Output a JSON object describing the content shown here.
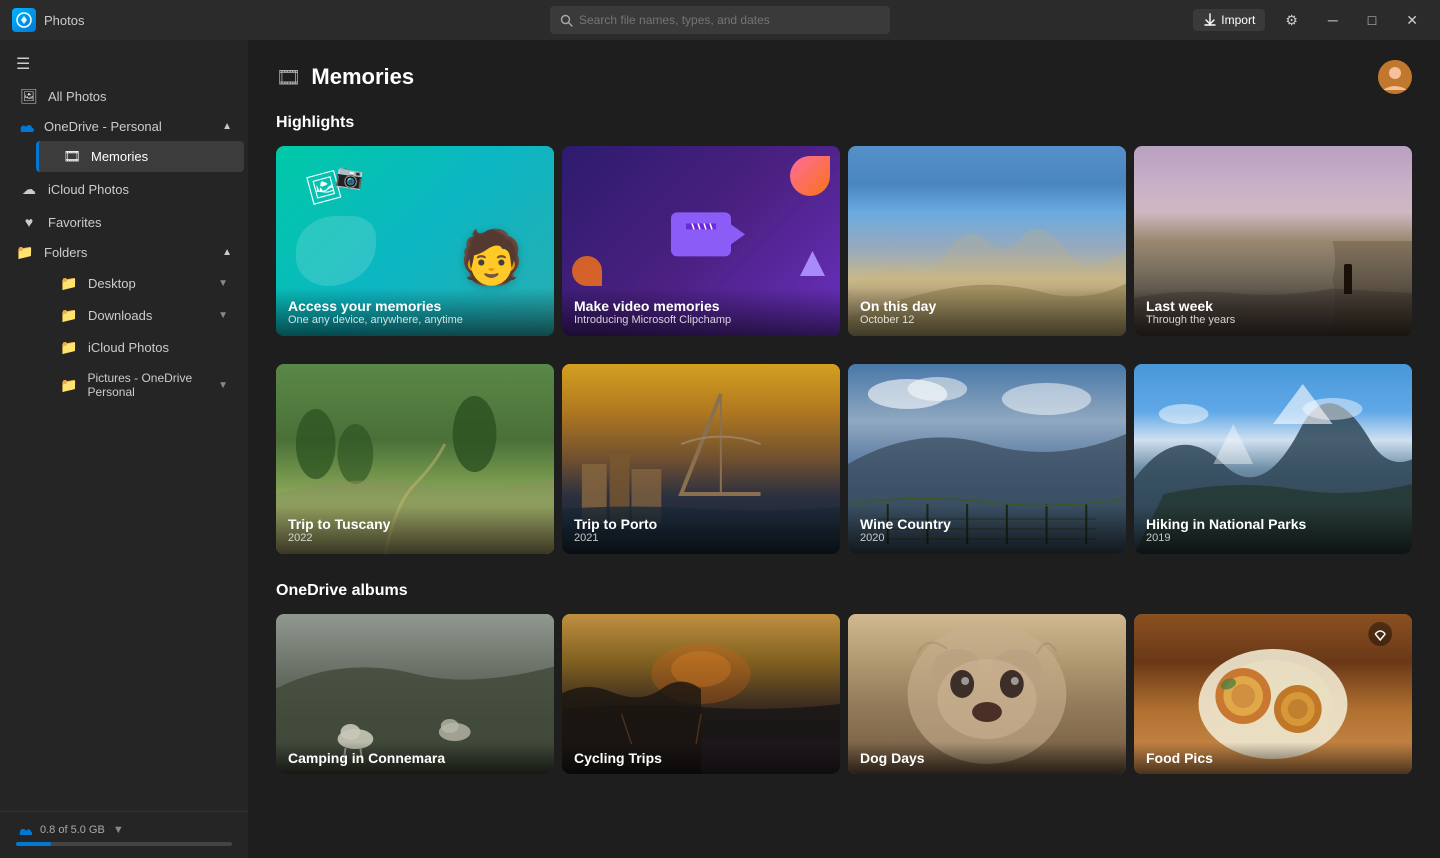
{
  "titlebar": {
    "app_name": "Photos",
    "search_placeholder": "Search file names, types, and dates",
    "import_label": "Import"
  },
  "sidebar": {
    "hamburger": "☰",
    "all_photos": "All Photos",
    "onedrive_section": "OneDrive - Personal",
    "memories_label": "Memories",
    "icloud_label": "iCloud Photos",
    "favorites_label": "Favorites",
    "folders_label": "Folders",
    "desktop_label": "Desktop",
    "downloads_label": "Downloads",
    "icloud_folder_label": "iCloud Photos",
    "pictures_label": "Pictures - OneDrive Personal",
    "storage_text": "0.8 of 5.0 GB",
    "storage_pct": 16
  },
  "page": {
    "title": "Memories",
    "highlights_heading": "Highlights",
    "onedrive_albums_heading": "OneDrive albums"
  },
  "highlights": [
    {
      "id": "access-memories",
      "title": "Access your memories",
      "subtitle": "One any device, anywhere, anytime",
      "type": "promo1"
    },
    {
      "id": "video-memories",
      "title": "Make video memories",
      "subtitle": "Introducing Microsoft Clipchamp",
      "type": "promo2"
    },
    {
      "id": "on-this-day",
      "title": "On this day",
      "subtitle": "October 12",
      "type": "coastal"
    },
    {
      "id": "last-week",
      "title": "Last week",
      "subtitle": "Through the years",
      "type": "desert"
    }
  ],
  "memories": [
    {
      "id": "tuscany",
      "title": "Trip to Tuscany",
      "year": "2022",
      "type": "tuscany"
    },
    {
      "id": "porto",
      "title": "Trip to Porto",
      "year": "2021",
      "type": "porto"
    },
    {
      "id": "wine-country",
      "title": "Wine Country",
      "year": "2020",
      "type": "wine"
    },
    {
      "id": "hiking",
      "title": "Hiking in National Parks",
      "year": "2019",
      "type": "hiking"
    }
  ],
  "albums": [
    {
      "id": "connemara",
      "title": "Camping in Connemara",
      "type": "connemara"
    },
    {
      "id": "cycling",
      "title": "Cycling Trips",
      "type": "cycling"
    },
    {
      "id": "dog",
      "title": "Dog Days",
      "type": "dog"
    },
    {
      "id": "food",
      "title": "Food Pics",
      "type": "food"
    }
  ]
}
